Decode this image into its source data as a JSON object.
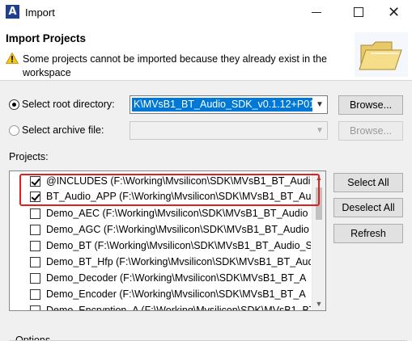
{
  "window": {
    "title": "Import",
    "close_glyph": "✕"
  },
  "header": {
    "title": "Import Projects",
    "message": "Some projects cannot be imported because they already exist in the workspace"
  },
  "root_dir": {
    "label": "Select root directory:",
    "value": "K\\MVsB1_BT_Audio_SDK_v0.1.12+P01",
    "browse": "Browse..."
  },
  "archive": {
    "label": "Select archive file:",
    "browse": "Browse..."
  },
  "projects": {
    "label": "Projects:",
    "items": [
      {
        "text": "@INCLUDES (F:\\Working\\Mvsilicon\\SDK\\MVsB1_BT_Audi",
        "checked": true
      },
      {
        "text": "BT_Audio_APP (F:\\Working\\Mvsilicon\\SDK\\MVsB1_BT_Au",
        "checked": true
      },
      {
        "text": "Demo_AEC (F:\\Working\\Mvsilicon\\SDK\\MVsB1_BT_Audio",
        "checked": false
      },
      {
        "text": "Demo_AGC (F:\\Working\\Mvsilicon\\SDK\\MVsB1_BT_Audio",
        "checked": false
      },
      {
        "text": "Demo_BT (F:\\Working\\Mvsilicon\\SDK\\MVsB1_BT_Audio_S",
        "checked": false
      },
      {
        "text": "Demo_BT_Hfp (F:\\Working\\Mvsilicon\\SDK\\MVsB1_BT_Aud",
        "checked": false
      },
      {
        "text": "Demo_Decoder (F:\\Working\\Mvsilicon\\SDK\\MVsB1_BT_A",
        "checked": false
      },
      {
        "text": "Demo_Encoder (F:\\Working\\Mvsilicon\\SDK\\MVsB1_BT_A",
        "checked": false
      },
      {
        "text": "Demo_Encryption_A (F:\\Working\\Mvsilicon\\SDK\\MVsB1_BT",
        "checked": false
      }
    ]
  },
  "buttons": {
    "select_all": "Select All",
    "deselect_all": "Deselect All",
    "refresh": "Refresh"
  },
  "options": {
    "label": "Options"
  },
  "colors": {
    "selection": "#0078d7",
    "highlight": "#e02020"
  }
}
